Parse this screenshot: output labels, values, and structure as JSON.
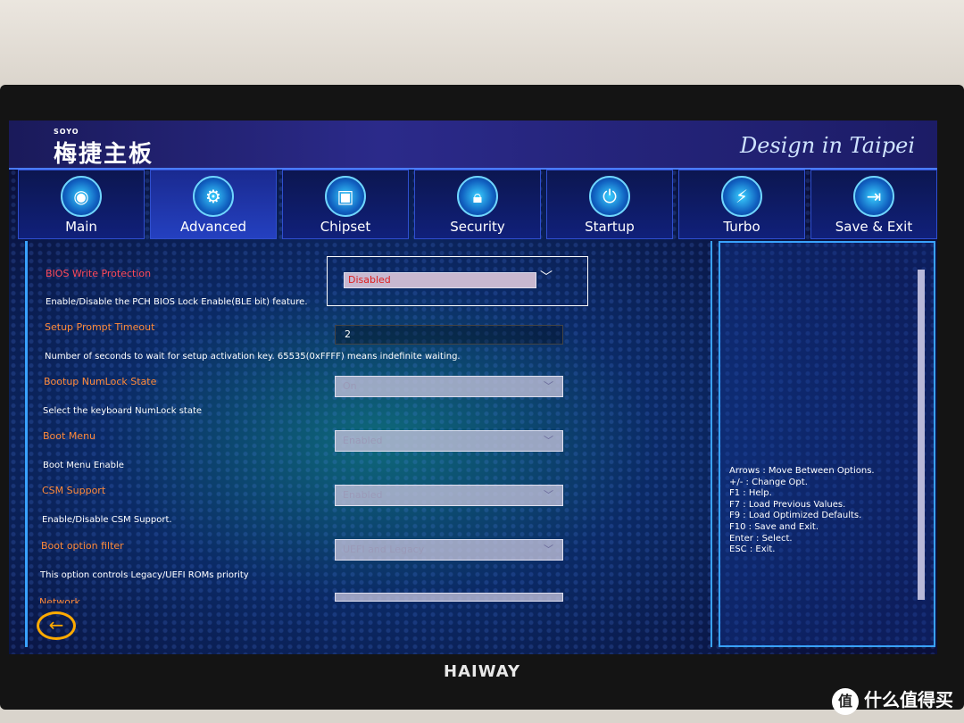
{
  "monitor_brand": "HAIWAY",
  "header": {
    "logo_sub": "SOYO",
    "logo": "梅捷主板",
    "slogan": "Design in Taipei"
  },
  "tabs": [
    {
      "label": "Main",
      "icon": "camera-icon"
    },
    {
      "label": "Advanced",
      "icon": "gear-icon"
    },
    {
      "label": "Chipset",
      "icon": "chip-icon"
    },
    {
      "label": "Security",
      "icon": "lock-icon"
    },
    {
      "label": "Startup",
      "icon": "power-icon"
    },
    {
      "label": "Turbo",
      "icon": "turbo-icon"
    },
    {
      "label": "Save & Exit",
      "icon": "exit-icon"
    }
  ],
  "settings": [
    {
      "label": "BIOS Write Protection",
      "value": "Disabled",
      "desc": "Enable/Disable the PCH BIOS Lock Enable(BLE bit) feature."
    },
    {
      "label": "Setup Prompt Timeout",
      "value": "2",
      "desc": "Number of seconds to wait for setup activation key. 65535(0xFFFF) means indefinite waiting."
    },
    {
      "label": "Bootup NumLock State",
      "value": "On",
      "desc": "Select the keyboard NumLock state"
    },
    {
      "label": "Boot Menu",
      "value": "Enabled",
      "desc": "Boot Menu Enable"
    },
    {
      "label": "CSM Support",
      "value": "Enabled",
      "desc": "Enable/Disable CSM Support."
    },
    {
      "label": "Boot option filter",
      "value": "UEFI and Legacy",
      "desc": "This option controls Legacy/UEFI ROMs priority"
    },
    {
      "label": "Network",
      "value": "",
      "desc": ""
    }
  ],
  "help": [
    "Arrows : Move Between Options.",
    "+/- : Change Opt.",
    "F1 : Help.",
    "F7 : Load Previous Values.",
    "F9 : Load Optimized Defaults.",
    "F10 : Save and Exit.",
    "Enter : Select.",
    "ESC : Exit."
  ],
  "back_icon": "←",
  "watermark": "什么值得买",
  "watermark_icon": "值"
}
